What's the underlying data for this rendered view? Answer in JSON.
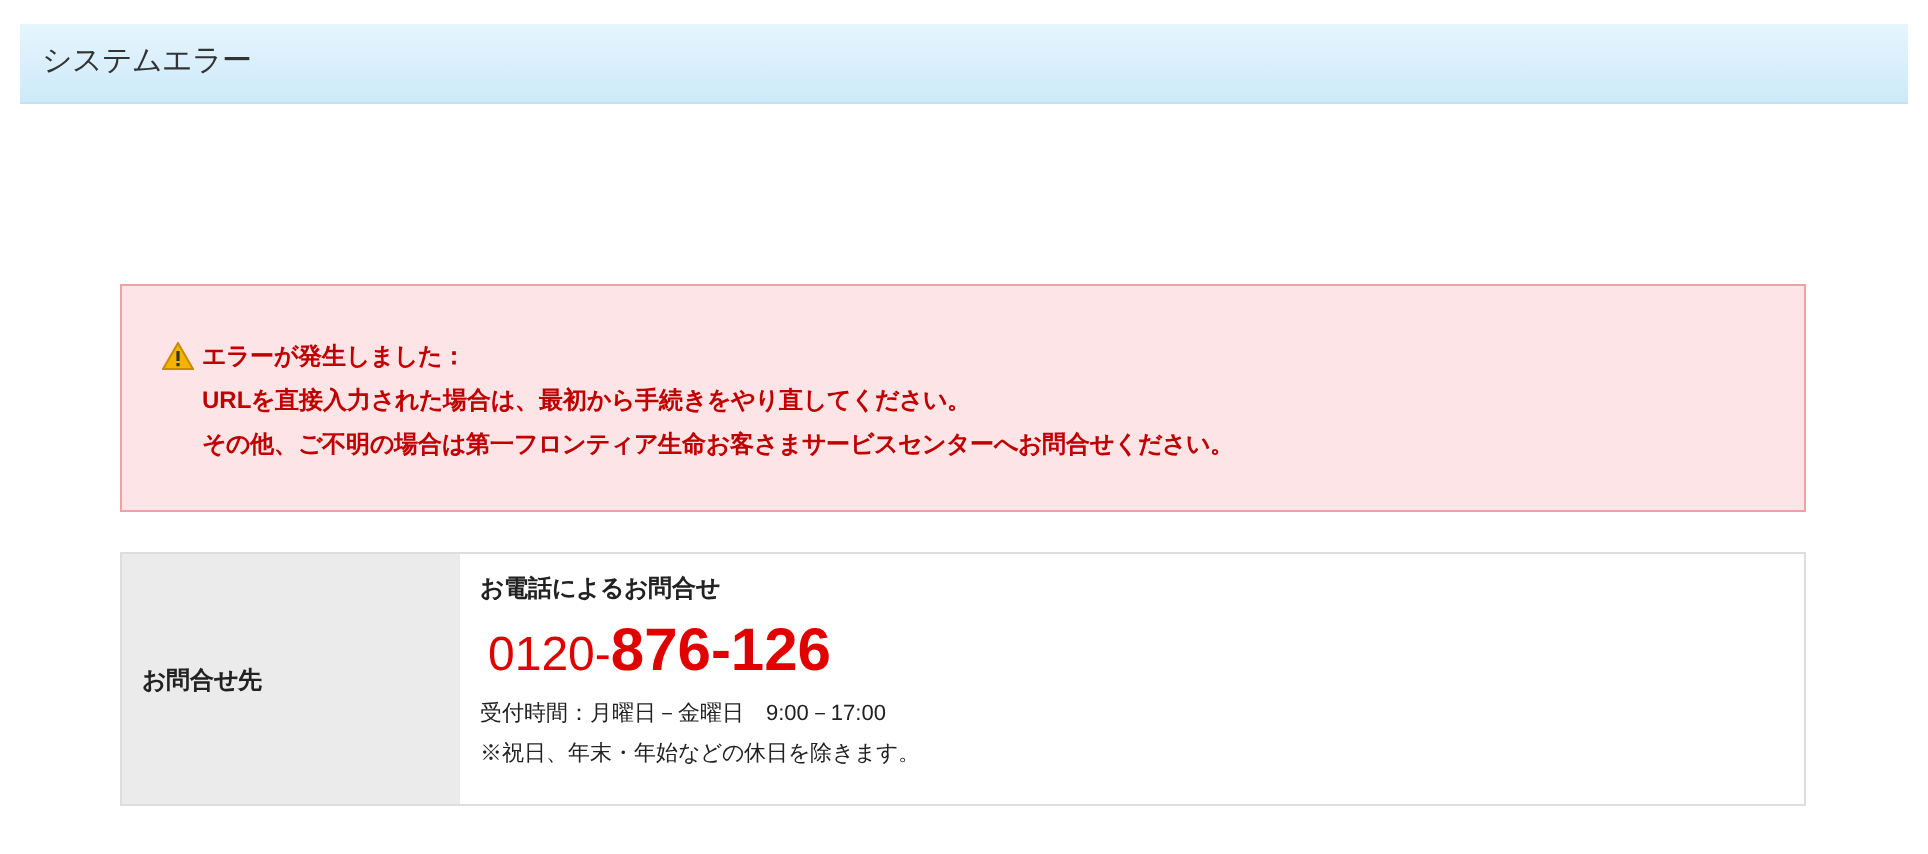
{
  "page_title": "システムエラー",
  "error": {
    "heading": "エラーが発生しました：",
    "lines": [
      "URLを直接入力された場合は、最初から手続きをやり直してください。",
      "その他、ご不明の場合は第一フロンティア生命お客さまサービスセンターへお問合せください。"
    ]
  },
  "contact": {
    "label": "お問合せ先",
    "title": "お電話によるお問合せ",
    "phone_prefix": "0120-",
    "phone_number": "876-126",
    "hours": "受付時間：月曜日－金曜日　9:00－17:00",
    "note": "※祝日、年末・年始などの休日を除きます。"
  }
}
